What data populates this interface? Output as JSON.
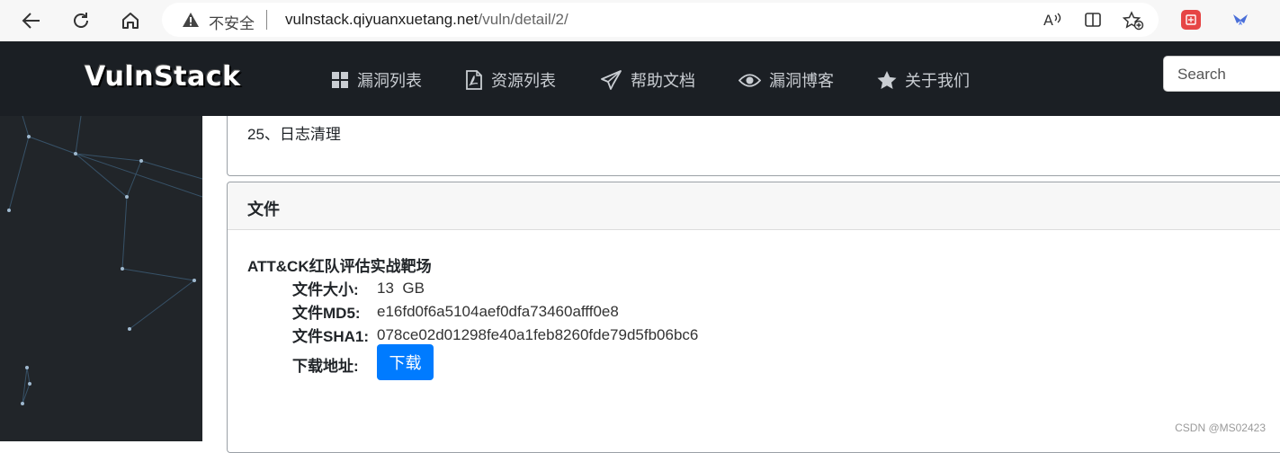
{
  "browser": {
    "insecure_label": "不安全",
    "url_host": "vulnstack.qiyuanxuetang.net",
    "url_path": "/vuln/detail/2/"
  },
  "site": {
    "brand": "VulnStack",
    "menu": [
      {
        "icon": "grid-icon",
        "label": "漏洞列表"
      },
      {
        "icon": "pdf-file-icon",
        "label": "资源列表"
      },
      {
        "icon": "paper-plane-icon",
        "label": "帮助文档"
      },
      {
        "icon": "eye-icon",
        "label": "漏洞博客"
      },
      {
        "icon": "star-icon",
        "label": "关于我们"
      }
    ],
    "search_placeholder": "Search"
  },
  "content": {
    "prev_card_text": "25、日志清理",
    "files_header": "文件",
    "file": {
      "title": "ATT&CK红队评估实战靶场",
      "size_label": "文件大小:",
      "size_value": "13  GB",
      "md5_label": "文件MD5:",
      "md5_value": "e16fd0f6a5104aef0dfa73460afff0e8",
      "sha1_label": "文件SHA1:",
      "sha1_value": "078ce02d01298fe40a1feb8260fde79d5fb06bc6",
      "download_label": "下载地址:",
      "download_button": "下载"
    }
  },
  "watermark": "CSDN @MS02423",
  "colors": {
    "header_bg": "#1b1f24",
    "sidebar_bg": "#212529",
    "primary_button": "#007bff"
  }
}
